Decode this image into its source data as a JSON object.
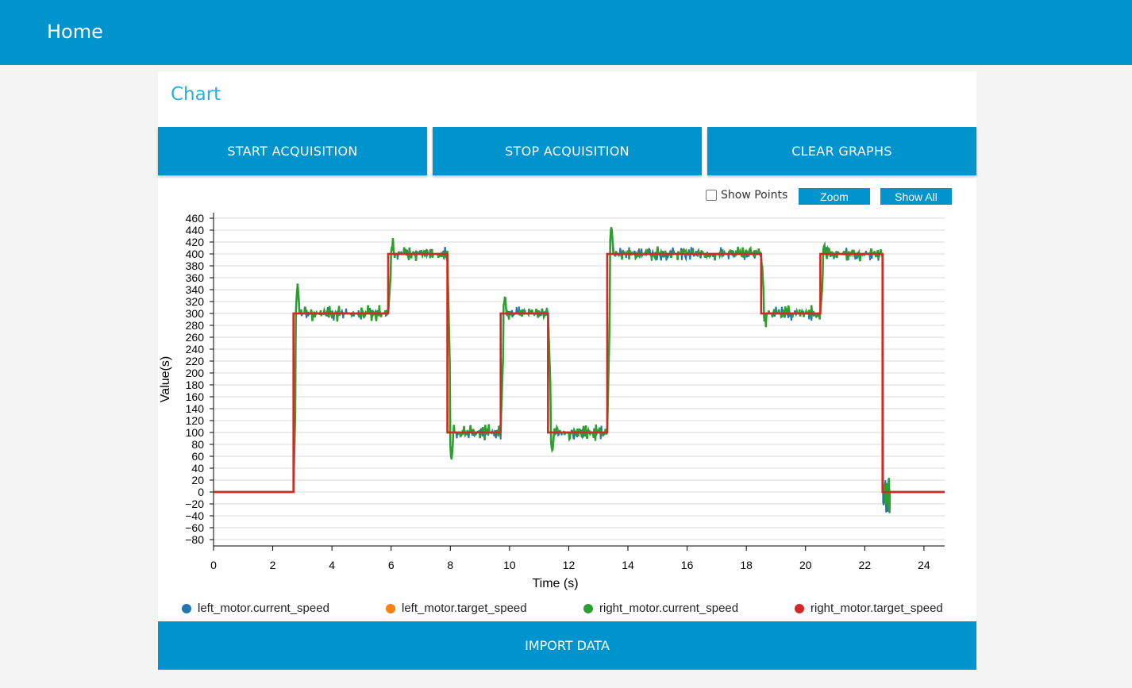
{
  "header": {
    "title": "Home"
  },
  "card": {
    "title": "Chart"
  },
  "toolbar": {
    "start_label": "START ACQUISITION",
    "stop_label": "STOP ACQUISITION",
    "clear_label": "CLEAR GRAPHS"
  },
  "chart_controls": {
    "show_points_label": "Show Points",
    "show_points_checked": false,
    "zoom_label": "Zoom",
    "show_all_label": "Show All"
  },
  "import_label": "IMPORT DATA",
  "colors": {
    "accent": "#0094cf",
    "left_current": "#1f77b4",
    "left_target": "#ff7f0e",
    "right_current": "#2ca02c",
    "right_target": "#d62728"
  },
  "chart_data": {
    "type": "line",
    "xlabel": "Time (s)",
    "ylabel": "Value(s)",
    "xlim": [
      0,
      24.7
    ],
    "ylim": [
      -90,
      465
    ],
    "xticks": [
      0,
      2,
      4,
      6,
      8,
      10,
      12,
      14,
      16,
      18,
      20,
      22,
      24
    ],
    "yticks": [
      -80,
      -60,
      -40,
      -20,
      0,
      20,
      40,
      60,
      80,
      100,
      120,
      140,
      160,
      180,
      200,
      220,
      240,
      260,
      280,
      300,
      320,
      340,
      360,
      380,
      400,
      420,
      440,
      460
    ],
    "grid": true,
    "legend_position": "bottom",
    "target_steps": [
      [
        0,
        0
      ],
      [
        2.7,
        300
      ],
      [
        5.9,
        400
      ],
      [
        7.9,
        100
      ],
      [
        9.7,
        300
      ],
      [
        11.3,
        100
      ],
      [
        13.3,
        400
      ],
      [
        18.5,
        300
      ],
      [
        20.5,
        400
      ],
      [
        22.6,
        0
      ],
      [
        24.7,
        0
      ]
    ],
    "series": [
      {
        "name": "left_motor.current_speed",
        "color": "#1f77b4"
      },
      {
        "name": "left_motor.target_speed",
        "color": "#ff7f0e"
      },
      {
        "name": "right_motor.current_speed",
        "color": "#2ca02c"
      },
      {
        "name": "right_motor.target_speed",
        "color": "#d62728"
      }
    ]
  }
}
